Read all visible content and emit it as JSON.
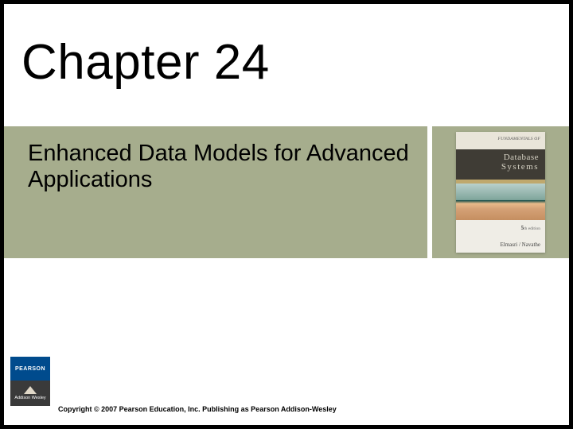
{
  "title": "Chapter 24",
  "subtitle": "Enhanced Data Models for Advanced Applications",
  "book": {
    "tagline": "FUNDAMENTALS OF",
    "title_line1": "Database",
    "title_line2": "Systems",
    "edition_num": "5",
    "edition_suffix": "th edition",
    "authors": "Elmasri / Navathe"
  },
  "publisher": {
    "brand_top": "PEARSON",
    "brand_bottom": "Addison\nWesley"
  },
  "copyright": "Copyright © 2007 Pearson Education, Inc. Publishing as Pearson Addison-Wesley"
}
